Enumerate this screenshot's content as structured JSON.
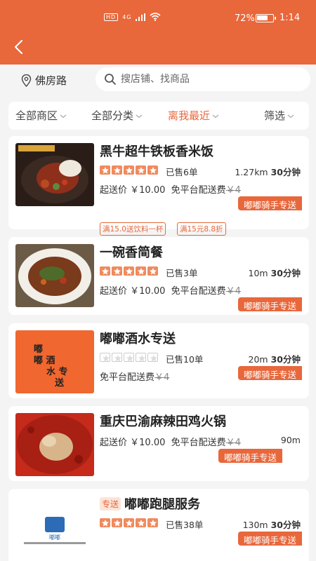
{
  "status_bar": {
    "network": "HD",
    "signal": "4G",
    "battery": "72%",
    "time": "1:14",
    "battery_level": 0.72
  },
  "location": "佛房路",
  "search": {
    "placeholder": "搜店铺、找商品"
  },
  "filters": [
    {
      "label": "全部商区",
      "active": false
    },
    {
      "label": "全部分类",
      "active": false
    },
    {
      "label": "离我最近",
      "active": true
    },
    {
      "label": "筛选",
      "active": false
    }
  ],
  "stores": [
    {
      "name": "黑牛超牛铁板香米饭",
      "rating": 5,
      "sold": "已售6单",
      "distance": "1.27km",
      "time": "30分钟",
      "min_label": "起送价",
      "min_price": "￥10.00",
      "free_fee": "免平台配送费",
      "old_fee": "￥4",
      "rider": "嘟嘟骑手专送",
      "promos": [
        "满15.0送饮料一杯",
        "满15元8.8折"
      ]
    },
    {
      "name": "一碗香简餐",
      "rating": 5,
      "sold": "已售3单",
      "distance": "10m",
      "time": "30分钟",
      "min_label": "起送价",
      "min_price": "￥10.00",
      "free_fee": "免平台配送费",
      "old_fee": "￥4",
      "rider": "嘟嘟骑手专送"
    },
    {
      "name": "嘟嘟酒水专送",
      "rating": 0,
      "sold": "已售10单",
      "distance": "20m",
      "time": "30分钟",
      "free_fee": "免平台配送费",
      "old_fee": "￥4",
      "rider": "嘟嘟骑手专送",
      "logo_text": [
        "嘟",
        "嘟 酒",
        "水 专",
        "送"
      ]
    },
    {
      "name": "重庆巴渝麻辣田鸡火锅",
      "distance": "90m",
      "min_label": "起送价",
      "min_price": "￥10.00",
      "free_fee": "免平台配送费",
      "old_fee": "￥4",
      "rider": "嘟嘟骑手专送"
    },
    {
      "tag": "专送",
      "name": "嘟嘟跑腿服务",
      "rating": 5,
      "sold": "已售38单",
      "distance": "130m",
      "time": "30分钟",
      "rider": "嘟嘟骑手专送",
      "logo_text": "嘟嘟"
    }
  ],
  "colors": {
    "accent": "#e8673b",
    "star": "#f08a5d"
  },
  "icons": {
    "back": "back-arrow-icon",
    "location": "location-pin-icon",
    "search": "search-icon",
    "chevron": "chevron-down-icon",
    "star": "star-icon"
  }
}
